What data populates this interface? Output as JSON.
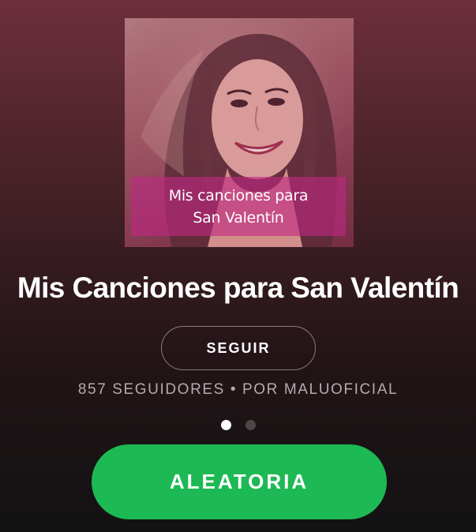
{
  "playlist": {
    "cover_caption_line1": "Mis canciones para",
    "cover_caption_line2": "San Valentín",
    "title": "Mis Canciones para San Valentín",
    "followers": "857 SEGUIDORES",
    "separator": "•",
    "owner": "POR MALUOFICIAL"
  },
  "actions": {
    "follow_label": "SEGUIR",
    "shuffle_label": "ALEATORIA"
  },
  "pager": {
    "pages": 2,
    "active_index": 0
  },
  "colors": {
    "accent_green": "#1db954",
    "caption_overlay": "#be2882",
    "background_top": "#6e2f3c",
    "background_bottom": "#121212"
  }
}
